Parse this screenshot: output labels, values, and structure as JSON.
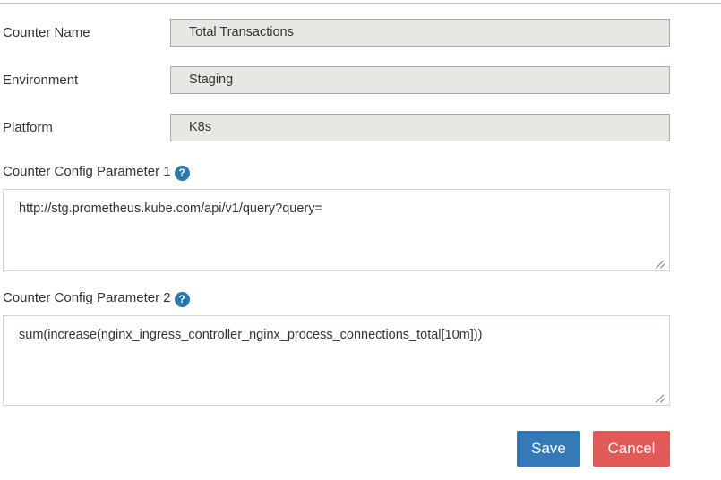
{
  "form": {
    "fields": [
      {
        "label": "Counter Name",
        "value": "Total Transactions"
      },
      {
        "label": "Environment",
        "value": "Staging"
      },
      {
        "label": "Platform",
        "value": "K8s"
      }
    ],
    "params": [
      {
        "label": "Counter Config Parameter 1",
        "help_icon": "help-question-icon",
        "help_glyph": "?",
        "value": "http://stg.prometheus.kube.com/api/v1/query?query="
      },
      {
        "label": "Counter Config Parameter 2",
        "help_icon": "help-question-icon",
        "help_glyph": "?",
        "value": "sum(increase(nginx_ingress_controller_nginx_process_connections_total[10m]))"
      }
    ]
  },
  "actions": {
    "save_label": "Save",
    "cancel_label": "Cancel"
  },
  "colors": {
    "save_button": "#337ab7",
    "cancel_button": "#e05a57",
    "help_icon": "#2a7ab0",
    "readonly_field": "#e9e7e2",
    "text": "#333333"
  }
}
